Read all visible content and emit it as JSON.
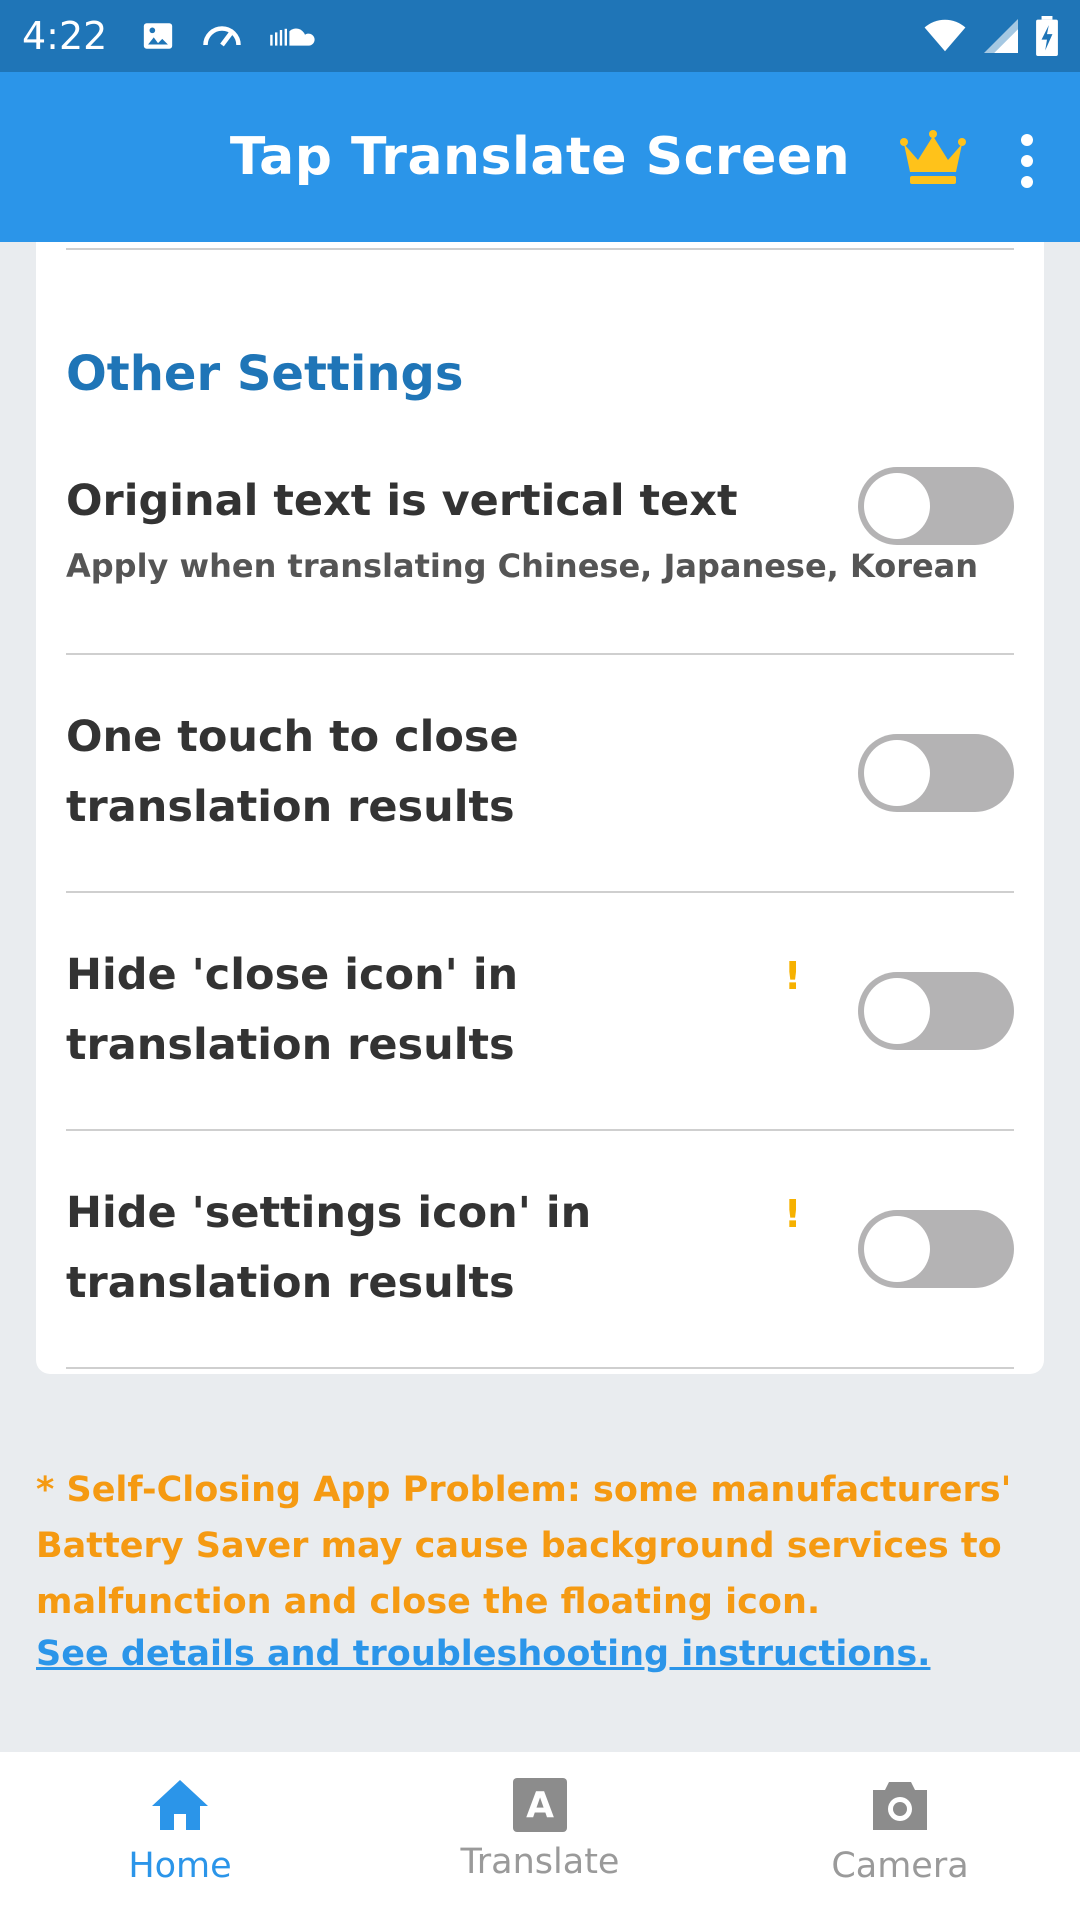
{
  "status_bar": {
    "time": "4:22"
  },
  "app_bar": {
    "title": "Tap Translate Screen"
  },
  "settings": {
    "section_title": "Other Settings",
    "items": [
      {
        "title": "Original text is vertical text",
        "subtitle": "Apply when translating Chinese, Japanese, Korean",
        "enabled": false
      },
      {
        "title": "One touch to close translation results",
        "enabled": false
      },
      {
        "title": "Hide 'close icon' in translation results",
        "warning_marker": "!",
        "enabled": false
      },
      {
        "title": "Hide 'settings icon' in translation results",
        "warning_marker": "!",
        "enabled": false
      }
    ]
  },
  "notice": {
    "text": "* Self-Closing App Problem: some manufacturers' Battery Saver may cause background services to malfunction and close the floating icon.",
    "link": "See details and troubleshooting instructions."
  },
  "bottom_nav": {
    "items": [
      {
        "label": "Home",
        "active": true
      },
      {
        "label": "Translate",
        "icon_letter": "A",
        "active": false
      },
      {
        "label": "Camera",
        "active": false
      }
    ]
  },
  "colors": {
    "status_bar": "#1f75b7",
    "app_bar": "#2b95e9",
    "accent": "#2b95e9",
    "section_title": "#1f75b7",
    "notice": "#f59a12",
    "warning": "#f6b100",
    "toggle_off": "#b4b3b4"
  }
}
